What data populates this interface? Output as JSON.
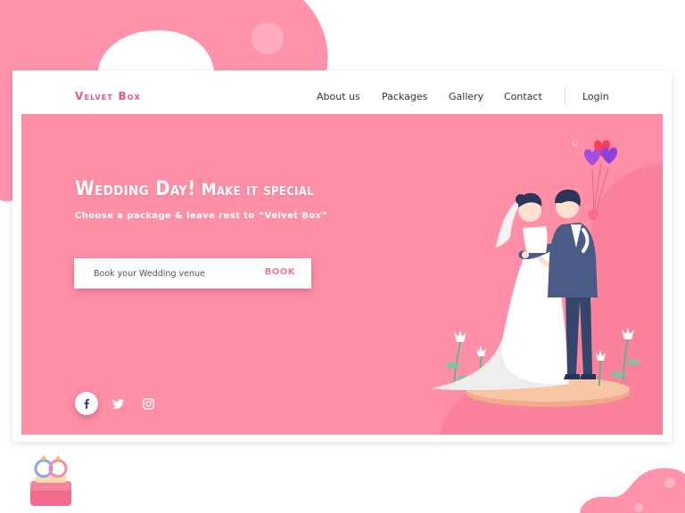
{
  "brand": {
    "name": "Velvet Box"
  },
  "nav": {
    "links": [
      "About us",
      "Packages",
      "Gallery",
      "Contact"
    ],
    "login": "Login"
  },
  "hero": {
    "headline_main": "Wedding Day!",
    "headline_secondary": "Make it special",
    "tagline": "Choose a package & leave rest to “Velvet Box”",
    "search_placeholder": "Book your Wedding venue",
    "book_label": "BOOK"
  },
  "social": {
    "icons": [
      "facebook-icon",
      "twitter-icon",
      "instagram-icon"
    ]
  },
  "colors": {
    "accent": "#e8577f",
    "hero_bg": "#fe8fa7",
    "blob": "#fe93ab"
  }
}
